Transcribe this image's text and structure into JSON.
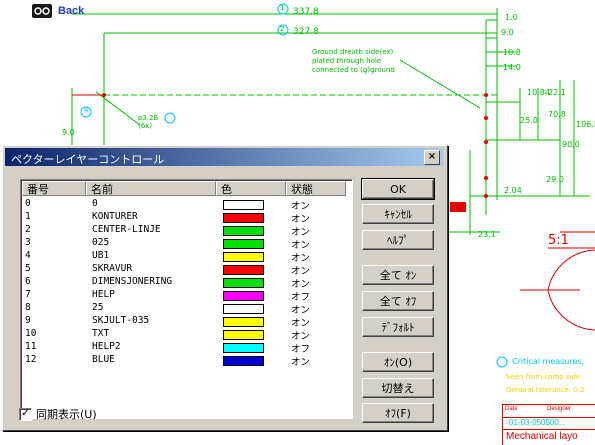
{
  "toolbar": {
    "back_label": "Back"
  },
  "drawing_annotations": {
    "dim_1": "1",
    "dim_337": "337.8",
    "dim_2": "2",
    "dim_327": "327.8",
    "dim_1_0": "1.0",
    "dim_9_0": "9.0",
    "note_ground": "Ground dreath side(ex)\nplated through hole\nconnected to (g)ground",
    "dim_10_8": "10.8",
    "dim_14_0": "14.0",
    "dim_10_84": "10.84",
    "dim_22_1": "22.1",
    "dim_70_8": "70.8",
    "dim_106_8": "106.8",
    "dim_90_0": "90.0",
    "dim_29_0": "29.0",
    "dim_25_0": "25.0",
    "dim_2_04": "2.04",
    "dim_23_1": "23.1",
    "dim_4": "4",
    "dim_9_0_left": "9.0",
    "hole_label": "ø3.2B\n(6x)",
    "scale_label": "5:1",
    "critical_note": "Critical measures,",
    "seen_note": "Seen from comp side",
    "general_note": "General tolerance: 0.2",
    "title_block": {
      "r1_a": "Date",
      "r1_b": "Designer",
      "r2": "01-03-050500...",
      "r3": "Mechanical layo"
    }
  },
  "dialog": {
    "title": "ペクターレイヤーコントロール",
    "close_label": "×",
    "columns": [
      "番号",
      "名前",
      "色",
      "状態"
    ],
    "layers": [
      {
        "num": "0",
        "name": "0",
        "color": "#ffffff",
        "state": "オン"
      },
      {
        "num": "1",
        "name": "KONTURER",
        "color": "#ff0000",
        "state": "オン"
      },
      {
        "num": "2",
        "name": "CENTER-LINJE",
        "color": "#00e000",
        "state": "オン"
      },
      {
        "num": "3",
        "name": "025",
        "color": "#00e000",
        "state": "オン"
      },
      {
        "num": "4",
        "name": "UB1",
        "color": "#ffff00",
        "state": "オン"
      },
      {
        "num": "5",
        "name": "SKRAVUR",
        "color": "#ff0000",
        "state": "オン"
      },
      {
        "num": "6",
        "name": "DIMENSJONERING",
        "color": "#00e000",
        "state": "オン"
      },
      {
        "num": "7",
        "name": "HELP",
        "color": "#ff00ff",
        "state": "オフ"
      },
      {
        "num": "8",
        "name": "25",
        "color": "#ffffff",
        "state": "オン"
      },
      {
        "num": "9",
        "name": "SKJULT-035",
        "color": "#ffff00",
        "state": "オン"
      },
      {
        "num": "10",
        "name": "TXT",
        "color": "#ffff00",
        "state": "オン"
      },
      {
        "num": "11",
        "name": "HELP2",
        "color": "#00ffff",
        "state": "オフ"
      },
      {
        "num": "12",
        "name": "BLUE",
        "color": "#0000d0",
        "state": "オン"
      }
    ],
    "buttons": {
      "ok": "OK",
      "cancel": "ｷｬﾝｾﾙ",
      "help": "ﾍﾙﾌﾟ",
      "all_on": "全て ｵﾝ",
      "all_off": "全て ｵﾌ",
      "default": "ﾃﾞﾌｫﾙﾄ",
      "on": "ｵﾝ(O)",
      "toggle": "切替え",
      "off": "ｵﾌ(F)"
    },
    "sync_label": "同期表示(U)",
    "sync_checked": true
  }
}
